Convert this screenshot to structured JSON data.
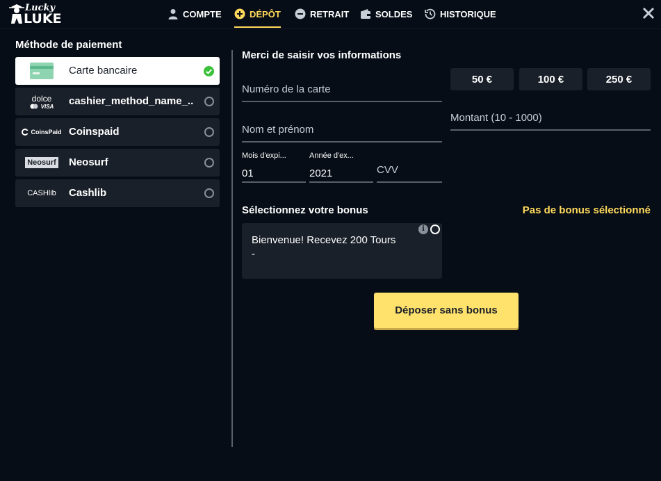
{
  "colors": {
    "accent": "#ffd95c",
    "background": "#060d16",
    "card": "#1a2029",
    "success": "#3cc13b"
  },
  "logo": {
    "line1": "Lucky",
    "line2": "LUKE"
  },
  "nav": [
    {
      "label": "COMPTE",
      "icon": "user-icon"
    },
    {
      "label": "DÉPÔT",
      "icon": "plus-circle-icon",
      "active": true
    },
    {
      "label": "RETRAIT",
      "icon": "minus-circle-icon"
    },
    {
      "label": "SOLDES",
      "icon": "wallet-icon"
    },
    {
      "label": "HISTORIQUE",
      "icon": "history-icon"
    }
  ],
  "payment": {
    "title": "Méthode de paiement",
    "methods": [
      {
        "label": "Carte bancaire",
        "logo": "credit-card",
        "selected": true
      },
      {
        "label": "cashier_method_name_...",
        "logo": "dolce",
        "logo_text": "dolce",
        "logo_sub": "VISA"
      },
      {
        "label": "Coinspaid",
        "logo": "coinspaid",
        "logo_text": "CoinsPaid"
      },
      {
        "label": "Neosurf",
        "logo": "neosurf",
        "logo_text": "Neosurf"
      },
      {
        "label": "Cashlib",
        "logo": "cashlib",
        "logo_text": "CASHlib"
      }
    ]
  },
  "form": {
    "title": "Merci de saisir vos informations",
    "card_number": {
      "placeholder": "Numéro de la carte"
    },
    "name": {
      "placeholder": "Nom et prénom"
    },
    "month": {
      "label": "Mois d'expi...",
      "value": "01"
    },
    "year": {
      "label": "Année d'ex...",
      "value": "2021"
    },
    "cvv": {
      "placeholder": "CVV"
    },
    "amount": {
      "placeholder": "Montant (10 - 1000)"
    },
    "presets": [
      "50 €",
      "100 €",
      "250 €"
    ]
  },
  "bonus": {
    "title": "Sélectionnez votre bonus",
    "status": "Pas de bonus sélectionné",
    "card_title": "Bienvenue! Recevez 200 Tours",
    "card_sub": "-",
    "info_glyph": "i"
  },
  "deposit_button": "Déposer sans bonus"
}
